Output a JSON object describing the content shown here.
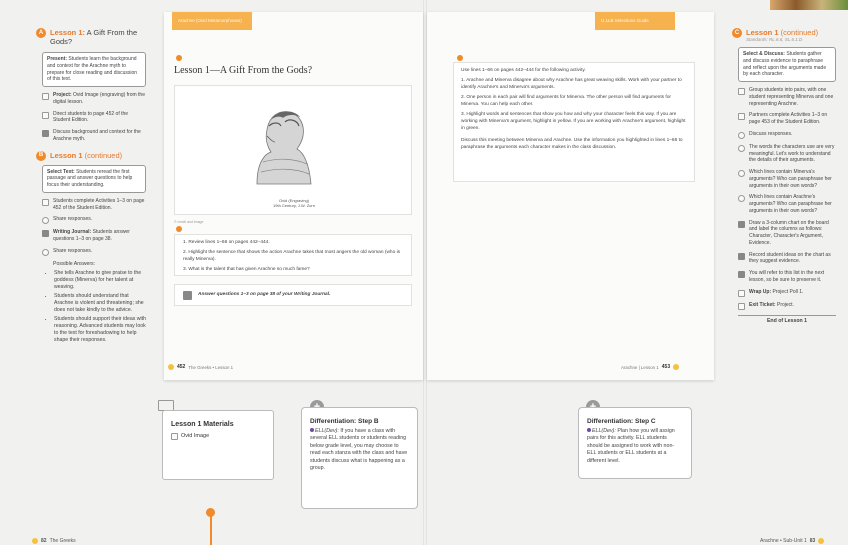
{
  "left_notes": {
    "lesson1": {
      "letter": "A",
      "title_bold": "Lesson 1:",
      "title_rest": " A Gift From the Gods?",
      "present_box_bold": "Present:",
      "present_box_text": " Students learn the background and context for the Arachne myth to prepare for close reading and discussion of this text.",
      "items": [
        {
          "bold": "Project:",
          "text": " Ovid Image (engraving) from the digital lesson."
        },
        {
          "bold": "",
          "text": "Direct students to page 452 of the Student Edition."
        },
        {
          "bold": "",
          "text": "Discuss background and context for the Arachne myth."
        }
      ]
    },
    "lesson1b": {
      "letter": "B",
      "title_bold": "Lesson 1",
      "title_rest": " (continued)",
      "select_box_bold": "Select Text:",
      "select_box_text": " Students reread the first passage and answer questions to help focus their understanding.",
      "items": [
        {
          "bold": "",
          "text": "Students complete Activities 1–3 on page 452 of the Student Edition."
        },
        {
          "bold": "",
          "text": "Share responses."
        },
        {
          "bold": "Writing Journal:",
          "text": " Students answer questions 1–3 on page 38."
        },
        {
          "bold": "",
          "text": "Share responses."
        }
      ],
      "possible_answers_label": "Possible Answers:",
      "answers": [
        "She tells Arachne to give praise to the goddess (Minerva) for her talent at weaving.",
        "Students should understand that Arachne is violent and threatening; she does not take kindly to the advice.",
        "Students should support their ideas with reasoning. Advanced students may look to the text for foreshadowing to help shape their responses."
      ]
    }
  },
  "left_page": {
    "tab": "Arachne (Ovid Metamorphoses)",
    "title": "Lesson 1—A Gift From the Gods?",
    "caption_line1": "Ovid (Engraving)",
    "caption_line2": "19th Century, J.W. Zorn",
    "image_credit": "© credit and image",
    "questions": [
      "1.  Review lines 1–66 on pages 442–444.",
      "2.  Highlight the sentence that shows the action Arachne takes that most angers the old woman (who is really Minerva).",
      "3.  What is the talent that has given Arachne so much fame?"
    ],
    "journal_text": "Answer questions 1–3 on page 38 of your Writing Journal.",
    "footer_page": "452",
    "footer_text": "The Greeks • Lesson 1"
  },
  "right_page": {
    "tab": "U.1LB Selections Guide",
    "intro": "Use lines 1–66 on pages 442–444 for the following activity.",
    "steps": [
      "1.  Arachne and Minerva disagree about why Arachne has great weaving skills. Work with your partner to identify Arachne's and Minerva's arguments.",
      "2.  One person in each pair will find arguments for Minerva. The other person will find arguments for Minerva. You can help each other.",
      "3.  Highlight words and sentences that show you how and why your character feels this way. If you are working with Minerva's argument, highlight in yellow. If you are working with Arachne's argument, highlight in green."
    ],
    "closing": "Discuss this meeting between Minerva and Arachne. Use the information you highlighted in lines 1–66 to paraphrase the arguments each character makes in the class discussion.",
    "footer_text": "Arachne | Lesson 1",
    "footer_page": "453"
  },
  "right_notes": {
    "letter": "C",
    "title_bold": "Lesson 1",
    "title_rest": " (continued)",
    "standards": "Standards: RL.6.6, SL.6.1.D",
    "box_bold": "Select & Discuss:",
    "box_text": " Students gather and discuss evidence to paraphrase and reflect upon the arguments made by each character.",
    "items": [
      {
        "bold": "",
        "text": "Group students into pairs, with one student representing Minerva and one representing Arachne."
      },
      {
        "bold": "",
        "text": "Partners complete Activities 1–3 on page 453 of the Student Edition."
      },
      {
        "bold": "",
        "text": "Discuss responses."
      },
      {
        "bold": "",
        "text": "The words the characters use are very meaningful. Let's work to understand the details of their arguments."
      },
      {
        "bold": "",
        "text": "Which lines contain Minerva's arguments? Who can paraphrase her arguments in their own words?"
      },
      {
        "bold": "",
        "text": "Which lines contain Arachne's arguments? Who can paraphrase her arguments in their own words?"
      },
      {
        "bold": "",
        "text": "Draw a 3-column chart on the board and label the columns as follows: Character, Character's Argument, Evidence."
      },
      {
        "bold": "",
        "text": "Record student ideas on the chart as they suggest evidence."
      },
      {
        "bold": "",
        "text": "You will refer to this list in the next lesson, so be sure to preserve it."
      },
      {
        "bold": "Wrap Up:",
        "text": " Project Poll 1."
      },
      {
        "bold": "Exit Ticket:",
        "text": " Project."
      }
    ],
    "end": "End of Lesson 1"
  },
  "below": {
    "materials_title": "Lesson 1 Materials",
    "materials_item": "Ovid Image",
    "diffB_title": "Differentiation: Step B",
    "diffB_label": "ELL(Dev):",
    "diffB_text": " If you have a class with several ELL students or students reading below grade level, you may choose to read each stanza with the class and have students discuss what is happening as a group.",
    "diffC_title": "Differentiation: Step C",
    "diffC_label": "ELL(Dev):",
    "diffC_text": " Plan how you will assign pairs for this activity. ELL students should be assigned to work with non-ELL students or ELL students at a different level."
  },
  "bottom": {
    "left_page": "82",
    "left_text": "The Greeks",
    "right_text": "Arachne • Sub-Unit 1",
    "right_page": "83"
  },
  "colors": {
    "accent": "#f08a2a",
    "tab": "#f6b24f",
    "dev": "#6b4fa0"
  }
}
